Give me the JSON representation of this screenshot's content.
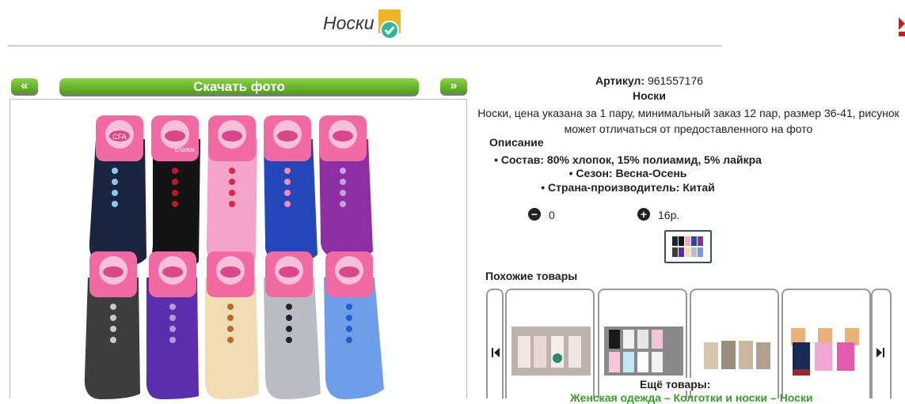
{
  "header": {
    "title": "Носки"
  },
  "gallery": {
    "prev_label": "«",
    "download_label": "Скачать фото",
    "next_label": "»",
    "photo_brand": "CFA",
    "photo_caption": "хлопок"
  },
  "product": {
    "article_label": "Артикул:",
    "article_value": "961557176",
    "name": "Носки",
    "description": "Носки, цена указана за 1 пару, минимальный заказ 12 пар, размер 36-41, рисунок может отличаться от предоставленного на фото",
    "desc_heading": "Описание",
    "specs": [
      "Состав: 80% хлопок, 15% полиамид, 5% лайкра",
      "Сезон: Весна-Осень",
      "Страна-производитель: Китай"
    ],
    "quantity": "0",
    "price": "16р."
  },
  "similar": {
    "heading": "Похожие товары",
    "more_heading": "Ещё товары:",
    "more_links": "Женская одежда – Колготки и носки – Носки"
  },
  "colors": {
    "accent_green": "#5aa81e",
    "icon_bg": "#f0b429",
    "check_teal": "#2fb59a"
  }
}
